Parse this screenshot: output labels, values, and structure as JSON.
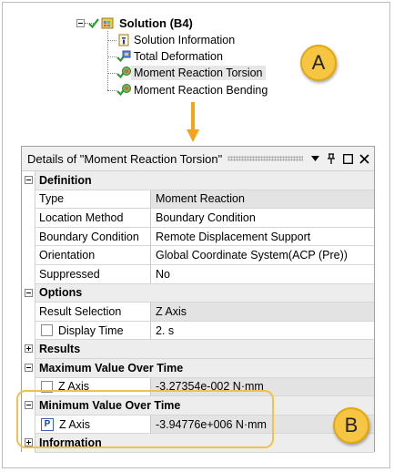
{
  "tree": {
    "root_label": "Solution (B4)",
    "items": [
      {
        "label": "Solution Information",
        "icon": "solution-information-icon"
      },
      {
        "label": "Total Deformation",
        "icon": "total-deformation-icon"
      },
      {
        "label": "Moment Reaction Torsion",
        "icon": "moment-reaction-icon",
        "selected": true
      },
      {
        "label": "Moment Reaction Bending",
        "icon": "moment-reaction-icon"
      }
    ]
  },
  "callouts": {
    "a": "A",
    "b": "B"
  },
  "panel": {
    "title": "Details of \"Moment Reaction Torsion\"",
    "pin_glyph": "ք",
    "sections": {
      "definition": "Definition",
      "options": "Options",
      "results": "Results",
      "max": "Maximum Value Over Time",
      "min": "Minimum Value Over Time",
      "information": "Information"
    },
    "rows": {
      "type": {
        "name": "Type",
        "value": "Moment Reaction"
      },
      "location_method": {
        "name": "Location Method",
        "value": "Boundary Condition"
      },
      "boundary_condition": {
        "name": "Boundary Condition",
        "value": "Remote Displacement Support"
      },
      "orientation": {
        "name": "Orientation",
        "value": "Global Coordinate System(ACP (Pre))"
      },
      "suppressed": {
        "name": "Suppressed",
        "value": "No"
      },
      "result_selection": {
        "name": "Result Selection",
        "value": "Z Axis"
      },
      "display_time": {
        "name": "Display Time",
        "value": "2. s"
      },
      "max_z": {
        "name": "Z Axis",
        "value": "-3.27354e-002 N·mm"
      },
      "min_z": {
        "name": "Z Axis",
        "value": "-3.94776e+006 N·mm"
      }
    },
    "badge_p": "P"
  },
  "colors": {
    "callout": "#f6c542",
    "check": "#2e9a2e",
    "highlight": "#f2c14a"
  }
}
